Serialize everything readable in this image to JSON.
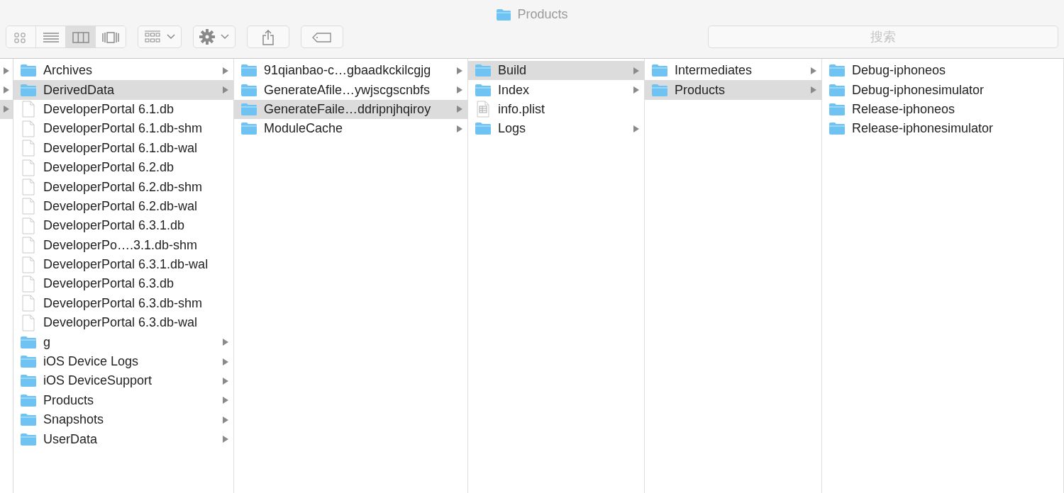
{
  "window": {
    "title": "Products"
  },
  "toolbar": {
    "view_modes": [
      {
        "kind": "icon",
        "selected": false
      },
      {
        "kind": "list",
        "selected": false
      },
      {
        "kind": "column",
        "selected": true
      },
      {
        "kind": "coverflow",
        "selected": false
      }
    ],
    "search": {
      "placeholder": "搜索"
    }
  },
  "partial_column": [
    {
      "selected": false
    },
    {
      "selected": false
    },
    {
      "selected": true
    }
  ],
  "columns": [
    {
      "items": [
        {
          "kind": "folder",
          "name": "Archives",
          "expandable": true,
          "selected": false
        },
        {
          "kind": "folder",
          "name": "DerivedData",
          "expandable": true,
          "selected": true
        },
        {
          "kind": "file",
          "name": "DeveloperPortal 6.1.db",
          "expandable": false,
          "selected": false
        },
        {
          "kind": "file",
          "name": "DeveloperPortal 6.1.db-shm",
          "expandable": false,
          "selected": false
        },
        {
          "kind": "file",
          "name": "DeveloperPortal 6.1.db-wal",
          "expandable": false,
          "selected": false
        },
        {
          "kind": "file",
          "name": "DeveloperPortal 6.2.db",
          "expandable": false,
          "selected": false
        },
        {
          "kind": "file",
          "name": "DeveloperPortal 6.2.db-shm",
          "expandable": false,
          "selected": false
        },
        {
          "kind": "file",
          "name": "DeveloperPortal 6.2.db-wal",
          "expandable": false,
          "selected": false
        },
        {
          "kind": "file",
          "name": "DeveloperPortal 6.3.1.db",
          "expandable": false,
          "selected": false
        },
        {
          "kind": "file",
          "name": "DeveloperPo….3.1.db-shm",
          "expandable": false,
          "selected": false
        },
        {
          "kind": "file",
          "name": "DeveloperPortal 6.3.1.db-wal",
          "expandable": false,
          "selected": false
        },
        {
          "kind": "file",
          "name": "DeveloperPortal 6.3.db",
          "expandable": false,
          "selected": false
        },
        {
          "kind": "file",
          "name": "DeveloperPortal 6.3.db-shm",
          "expandable": false,
          "selected": false
        },
        {
          "kind": "file",
          "name": "DeveloperPortal 6.3.db-wal",
          "expandable": false,
          "selected": false
        },
        {
          "kind": "folder",
          "name": "g",
          "expandable": true,
          "selected": false
        },
        {
          "kind": "folder",
          "name": "iOS Device Logs",
          "expandable": true,
          "selected": false
        },
        {
          "kind": "folder",
          "name": "iOS DeviceSupport",
          "expandable": true,
          "selected": false
        },
        {
          "kind": "folder",
          "name": "Products",
          "expandable": true,
          "selected": false
        },
        {
          "kind": "folder",
          "name": "Snapshots",
          "expandable": true,
          "selected": false
        },
        {
          "kind": "folder",
          "name": "UserData",
          "expandable": true,
          "selected": false
        }
      ]
    },
    {
      "items": [
        {
          "kind": "folder",
          "name": "91qianbao-c…gbaadkckilcgjg",
          "expandable": true,
          "selected": false
        },
        {
          "kind": "folder",
          "name": "GenerateAfile…ywjscgscnbfs",
          "expandable": true,
          "selected": false
        },
        {
          "kind": "folder",
          "name": "GenerateFaile…ddripnjhqiroy",
          "expandable": true,
          "selected": true
        },
        {
          "kind": "folder",
          "name": "ModuleCache",
          "expandable": true,
          "selected": false
        }
      ]
    },
    {
      "items": [
        {
          "kind": "folder",
          "name": "Build",
          "expandable": true,
          "selected": true
        },
        {
          "kind": "folder",
          "name": "Index",
          "expandable": true,
          "selected": false
        },
        {
          "kind": "plist",
          "name": "info.plist",
          "expandable": false,
          "selected": false
        },
        {
          "kind": "folder",
          "name": "Logs",
          "expandable": true,
          "selected": false
        }
      ]
    },
    {
      "items": [
        {
          "kind": "folder",
          "name": "Intermediates",
          "expandable": true,
          "selected": false
        },
        {
          "kind": "folder",
          "name": "Products",
          "expandable": true,
          "selected": true
        }
      ]
    },
    {
      "items": [
        {
          "kind": "folder",
          "name": "Debug-iphoneos",
          "expandable": false,
          "selected": false
        },
        {
          "kind": "folder",
          "name": "Debug-iphonesimulator",
          "expandable": false,
          "selected": false
        },
        {
          "kind": "folder",
          "name": "Release-iphoneos",
          "expandable": false,
          "selected": false
        },
        {
          "kind": "folder",
          "name": "Release-iphonesimulator",
          "expandable": false,
          "selected": false
        }
      ]
    }
  ]
}
